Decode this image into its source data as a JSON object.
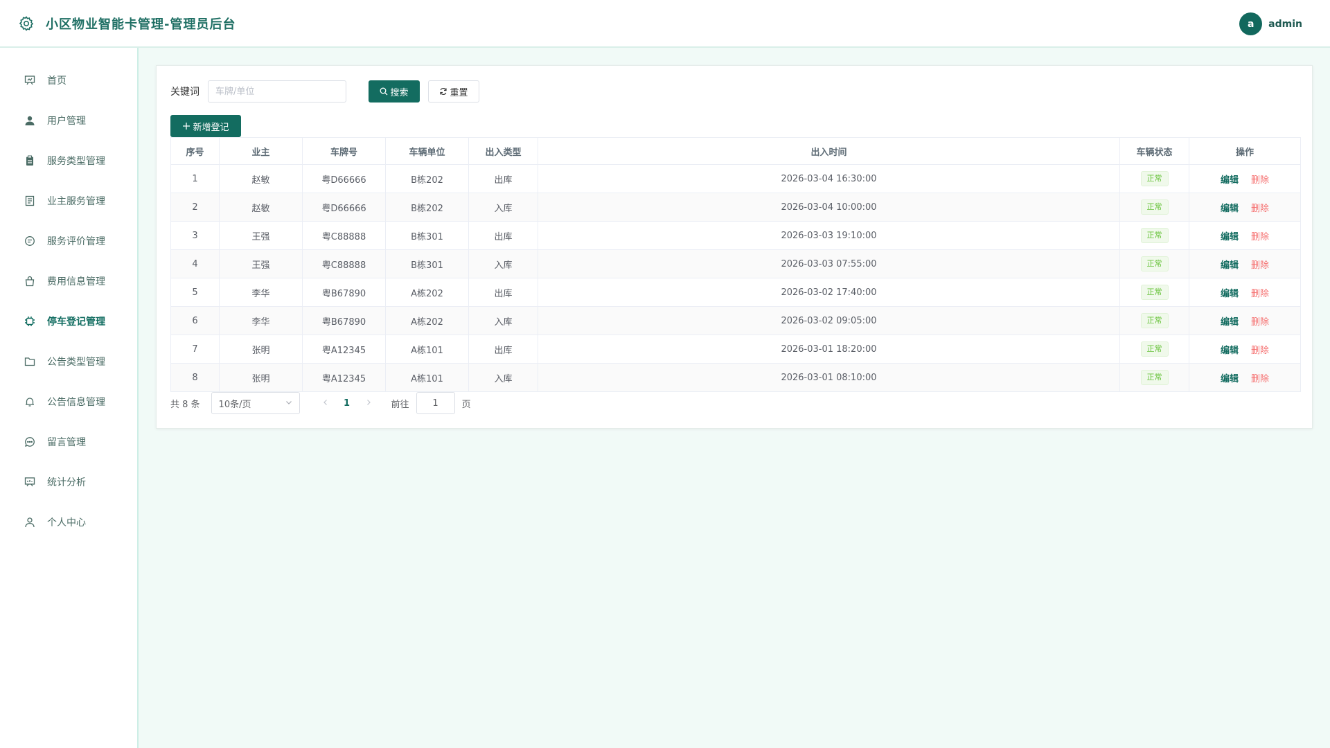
{
  "header": {
    "title": "小区物业智能卡管理-管理员后台",
    "logo_icon": "gear-icon",
    "avatar_letter": "a",
    "username": "admin"
  },
  "sidebar": {
    "items": [
      {
        "label": "首页",
        "icon": "presentation-icon"
      },
      {
        "label": "用户管理",
        "icon": "user-icon"
      },
      {
        "label": "服务类型管理",
        "icon": "clipboard-icon"
      },
      {
        "label": "业主服务管理",
        "icon": "document-icon"
      },
      {
        "label": "服务评价管理",
        "icon": "chat-icon"
      },
      {
        "label": "费用信息管理",
        "icon": "bag-icon"
      },
      {
        "label": "停车登记管理",
        "icon": "chip-icon",
        "active": true
      },
      {
        "label": "公告类型管理",
        "icon": "folder-icon"
      },
      {
        "label": "公告信息管理",
        "icon": "bell-icon"
      },
      {
        "label": "留言管理",
        "icon": "message-icon"
      },
      {
        "label": "统计分析",
        "icon": "chart-board-icon"
      },
      {
        "label": "个人中心",
        "icon": "user-outline-icon"
      }
    ]
  },
  "search": {
    "label": "关键词",
    "placeholder": "车牌/单位",
    "value": "",
    "search_button": "搜索",
    "reset_button": "重置",
    "add_button": "新增登记"
  },
  "table": {
    "columns": [
      "序号",
      "业主",
      "车牌号",
      "车辆单位",
      "出入类型",
      "出入时间",
      "车辆状态",
      "操作"
    ],
    "rows": [
      {
        "no": "1",
        "owner": "赵敏",
        "plate": "粤D66666",
        "unit": "B栋202",
        "type": "出库",
        "time": "2026-03-04 16:30:00",
        "status": "正常"
      },
      {
        "no": "2",
        "owner": "赵敏",
        "plate": "粤D66666",
        "unit": "B栋202",
        "type": "入库",
        "time": "2026-03-04 10:00:00",
        "status": "正常"
      },
      {
        "no": "3",
        "owner": "王强",
        "plate": "粤C88888",
        "unit": "B栋301",
        "type": "出库",
        "time": "2026-03-03 19:10:00",
        "status": "正常"
      },
      {
        "no": "4",
        "owner": "王强",
        "plate": "粤C88888",
        "unit": "B栋301",
        "type": "入库",
        "time": "2026-03-03 07:55:00",
        "status": "正常"
      },
      {
        "no": "5",
        "owner": "李华",
        "plate": "粤B67890",
        "unit": "A栋202",
        "type": "出库",
        "time": "2026-03-02 17:40:00",
        "status": "正常"
      },
      {
        "no": "6",
        "owner": "李华",
        "plate": "粤B67890",
        "unit": "A栋202",
        "type": "入库",
        "time": "2026-03-02 09:05:00",
        "status": "正常"
      },
      {
        "no": "7",
        "owner": "张明",
        "plate": "粤A12345",
        "unit": "A栋101",
        "type": "出库",
        "time": "2026-03-01 18:20:00",
        "status": "正常"
      },
      {
        "no": "8",
        "owner": "张明",
        "plate": "粤A12345",
        "unit": "A栋101",
        "type": "入库",
        "time": "2026-03-01 08:10:00",
        "status": "正常"
      }
    ],
    "edit_label": "编辑",
    "delete_label": "删除"
  },
  "pagination": {
    "total_text": "共 8 条",
    "page_size": "10条/页",
    "current_page": "1",
    "goto_label": "前往",
    "goto_value": "1",
    "page_unit": "页"
  },
  "colors": {
    "accent": "#136c60",
    "danger": "#f56c6c",
    "success": "#67c23a"
  }
}
